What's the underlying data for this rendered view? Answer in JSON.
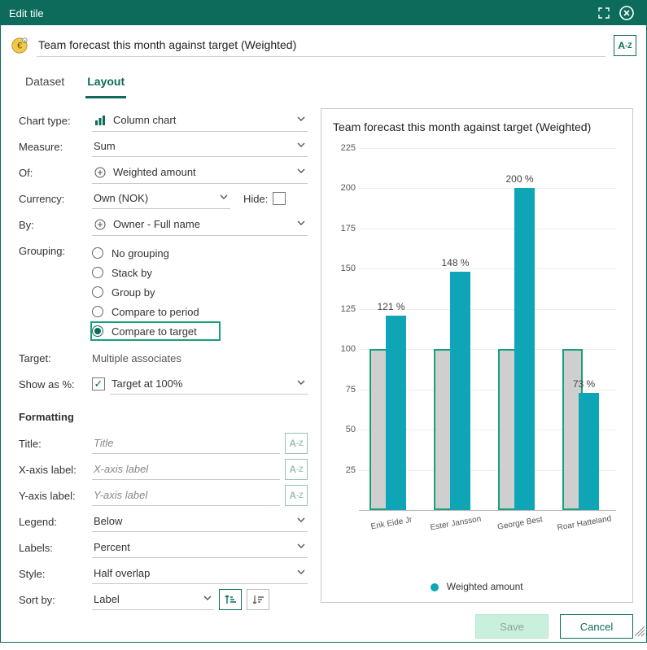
{
  "header": {
    "title": "Edit tile"
  },
  "tile_name": "Team forecast this month against target (Weighted)",
  "tabs": [
    {
      "id": "dataset",
      "label": "Dataset",
      "active": false
    },
    {
      "id": "layout",
      "label": "Layout",
      "active": true
    }
  ],
  "form": {
    "chart_type": {
      "label": "Chart type:",
      "value": "Column chart"
    },
    "measure": {
      "label": "Measure:",
      "value": "Sum"
    },
    "of": {
      "label": "Of:",
      "value": "Weighted amount"
    },
    "currency": {
      "label": "Currency:",
      "value": "Own (NOK)",
      "hide_label": "Hide:",
      "hide_checked": false
    },
    "by": {
      "label": "By:",
      "value": "Owner - Full name"
    },
    "grouping": {
      "label": "Grouping:",
      "options": [
        {
          "id": "none",
          "label": "No grouping"
        },
        {
          "id": "stack",
          "label": "Stack by"
        },
        {
          "id": "group",
          "label": "Group by"
        },
        {
          "id": "period",
          "label": "Compare to period"
        },
        {
          "id": "target",
          "label": "Compare to target",
          "selected": true,
          "highlight": true
        }
      ]
    },
    "target": {
      "label": "Target:",
      "value": "Multiple associates"
    },
    "show_as": {
      "label": "Show as %:",
      "value": "Target at 100%",
      "checked": true
    },
    "formatting_header": "Formatting",
    "title_f": {
      "label": "Title:",
      "placeholder": "Title"
    },
    "xaxis": {
      "label": "X-axis label:",
      "placeholder": "X-axis label"
    },
    "yaxis": {
      "label": "Y-axis label:",
      "placeholder": "Y-axis label"
    },
    "legend": {
      "label": "Legend:",
      "value": "Below"
    },
    "labels": {
      "label": "Labels:",
      "value": "Percent"
    },
    "style": {
      "label": "Style:",
      "value": "Half overlap"
    },
    "sort": {
      "label": "Sort by:",
      "value": "Label"
    }
  },
  "buttons": {
    "save": "Save",
    "cancel": "Cancel"
  },
  "chart_data": {
    "type": "bar",
    "title": "Team forecast this month against target (Weighted)",
    "ylim": [
      0,
      225
    ],
    "yticks": [
      25,
      50,
      75,
      100,
      125,
      150,
      175,
      200,
      225
    ],
    "target_pct": 100,
    "categories": [
      "Erik Eide Jr",
      "Ester Jansson",
      "George Best",
      "Roar Hatteland"
    ],
    "series": [
      {
        "name": "Weighted amount",
        "values": [
          121,
          148,
          200,
          73
        ],
        "color": "#0ea5b7"
      }
    ],
    "legend_position": "below",
    "label_suffix": " %"
  }
}
